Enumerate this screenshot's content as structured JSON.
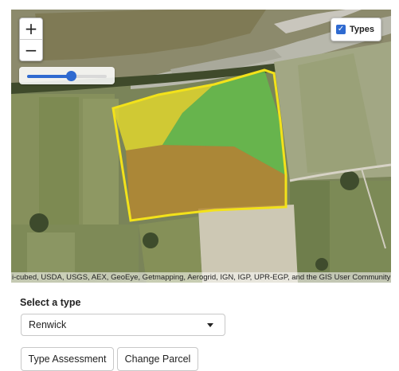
{
  "map": {
    "zoom_in_label": "+",
    "zoom_out_label": "−",
    "opacity_level": 0.55,
    "layers_control": {
      "label": "Types",
      "checked": true
    },
    "attribution": "i-cubed, USDA, USGS, AEX, GeoEye, Getmapping, Aerogrid, IGN, IGP, UPR-EGP, and the GIS User Community",
    "parcel": {
      "outline_color": "#f3e21a",
      "zones": [
        {
          "name": "yellow-zone",
          "color": "#e8dd2a"
        },
        {
          "name": "green-zone",
          "color": "#63c04a"
        },
        {
          "name": "brown-zone",
          "color": "#b8882e"
        }
      ]
    }
  },
  "form": {
    "select_label": "Select a type",
    "selected_type": "Renwick",
    "buttons": {
      "type_assessment": "Type Assessment",
      "change_parcel": "Change Parcel"
    }
  }
}
